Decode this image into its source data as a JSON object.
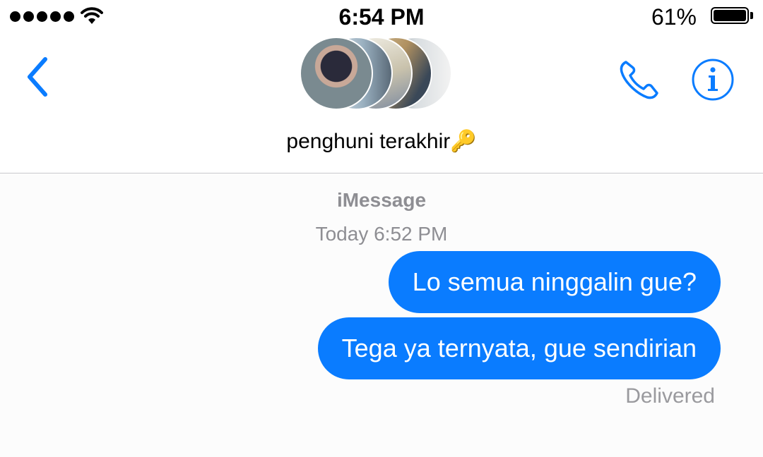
{
  "status_bar": {
    "time": "6:54 PM",
    "battery_percent": "61%",
    "battery_level": 0.61,
    "signal_icon": "signal-dots-icon",
    "wifi_icon": "wifi-icon"
  },
  "nav": {
    "back_icon": "chevron-left-icon",
    "chat_name": "penghuni terakhir🔑",
    "phone_icon": "phone-icon",
    "info_icon": "info-icon",
    "accent_color": "#0a7cff"
  },
  "conversation": {
    "service_label": "iMessage",
    "timestamp": "Today 6:52 PM",
    "messages": [
      {
        "text": "Lo semua ninggalin gue?",
        "sender": "me"
      },
      {
        "text": "Tega ya ternyata, gue sendirian",
        "sender": "me"
      }
    ],
    "delivery_status": "Delivered",
    "bubble_color": "#0a7cff"
  }
}
